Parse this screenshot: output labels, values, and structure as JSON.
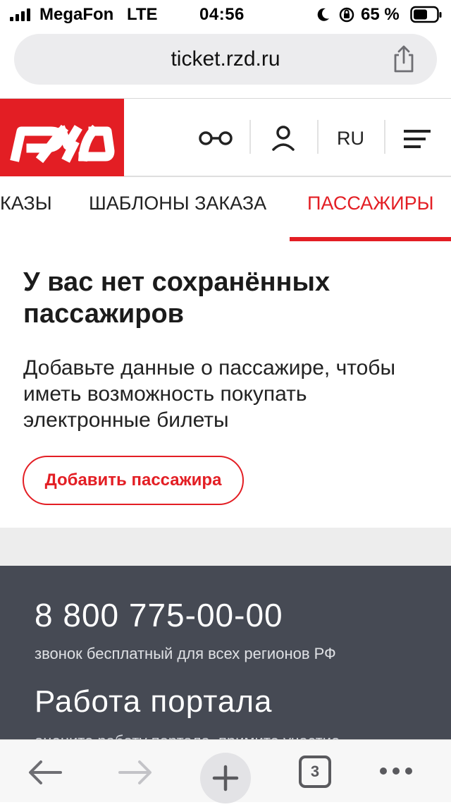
{
  "status_bar": {
    "carrier": "MegaFon",
    "network": "LTE",
    "time": "04:56",
    "battery_percent": "65 %"
  },
  "browser": {
    "url": "ticket.rzd.ru",
    "tab_count": "3"
  },
  "header": {
    "logo_text": "РЖД",
    "language": "RU",
    "brand_color": "#e31e24"
  },
  "tabs": [
    {
      "label": "ЗАКАЗЫ",
      "visible_text": "КАЗЫ",
      "active": false
    },
    {
      "label": "ШАБЛОНЫ ЗАКАЗА",
      "active": false
    },
    {
      "label": "ПАССАЖИРЫ",
      "active": true
    }
  ],
  "content": {
    "title": "У вас нет сохранённых пассажиров",
    "description": "Добавьте данные о пассажире, чтобы иметь возможность покупать электронные билеты",
    "add_button": "Добавить пассажира"
  },
  "footer": {
    "phone": "8 800 775-00-00",
    "phone_note": "звонок бесплатный для всех регионов РФ",
    "portal_heading": "Работа портала",
    "portal_note": "оцените работу портала, примите участие"
  }
}
